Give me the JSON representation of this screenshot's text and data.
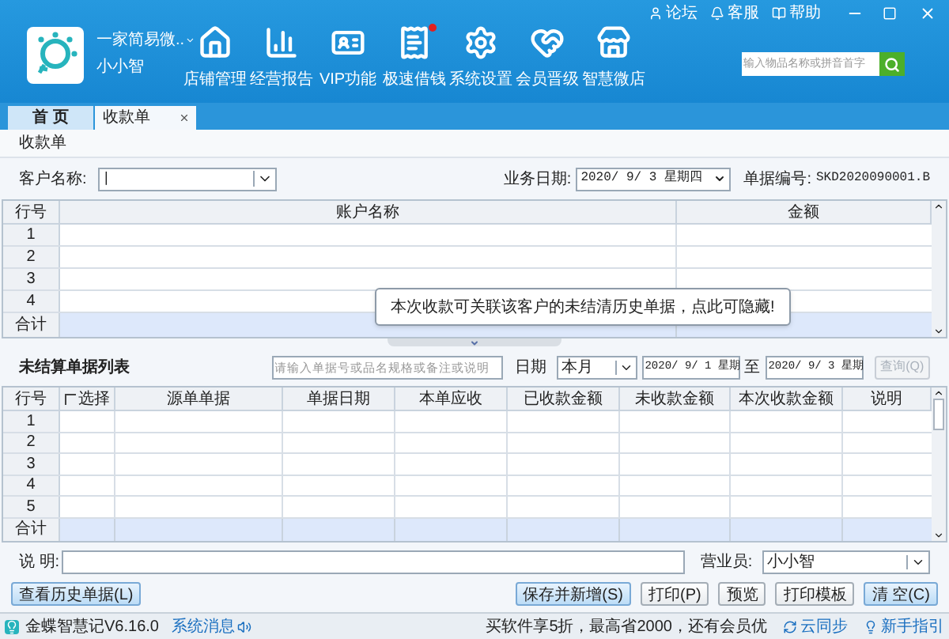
{
  "header": {
    "shop_name": "一家简易微..",
    "user": "小小智",
    "nav": [
      {
        "label": "店铺管理",
        "kind": "home",
        "dot": false
      },
      {
        "label": "经营报告",
        "kind": "chart",
        "dot": false
      },
      {
        "label": "VIP功能",
        "kind": "card",
        "dot": false
      },
      {
        "label": "极速借钱",
        "kind": "loan",
        "dot": true
      },
      {
        "label": "系统设置",
        "kind": "gear",
        "dot": false
      },
      {
        "label": "会员晋级",
        "kind": "heart",
        "dot": false
      },
      {
        "label": "智慧微店",
        "kind": "store",
        "dot": false
      }
    ],
    "links": [
      {
        "label": "论坛",
        "kind": "user"
      },
      {
        "label": "客服",
        "kind": "bell"
      },
      {
        "label": "帮助",
        "kind": "book"
      }
    ],
    "search": {
      "placeholder": "输入物品名称或拼音首字"
    }
  },
  "tabs": [
    {
      "label": "首 页",
      "selected": false,
      "closable": false
    },
    {
      "label": "收款单",
      "selected": true,
      "closable": true
    }
  ],
  "form": {
    "title": "收款单",
    "customer_label": "客户名称:",
    "customer_value": "|",
    "date_label": "业务日期:",
    "date": "2020/ 9/ 3 星期四",
    "number_label": "单据编号:",
    "number": "SKD2020090001.B"
  },
  "accounts_table": {
    "columns": [
      "行号",
      "账户名称",
      "金额"
    ],
    "rows": [
      "1",
      "2",
      "3",
      "4"
    ],
    "total_label": "合计"
  },
  "tooltip": "本次收款可关联该客户的未结清历史单据，点此可隐藏!",
  "unsettled": {
    "title": "未结算单据列表",
    "search_placeholder": "请输入单据号或品名规格或备注或说明",
    "date_label": "日期",
    "period": "本月",
    "from": "2020/ 9/ 1 星期",
    "to_label": "至",
    "to": "2020/ 9/ 3 星期",
    "query": {
      "label": "查询(Q)",
      "disabled": true
    },
    "select_all": {
      "label": "选择",
      "checked": false
    },
    "columns": [
      "行号",
      "源单单据",
      "单据日期",
      "本单应收",
      "已收款金额",
      "未收款金额",
      "本次收款金额",
      "说明"
    ],
    "rows": [
      "1",
      "2",
      "3",
      "4",
      "5"
    ],
    "total_label": "合计"
  },
  "note_label": "说 明:",
  "salesperson_label": "营业员:",
  "salesperson": "小小智",
  "buttons": [
    {
      "label": "查看历史单据(L)",
      "primary": true
    },
    {
      "label": "保存并新增(S)",
      "primary": true
    },
    {
      "label": "打印(P)",
      "primary": false
    },
    {
      "label": "预览",
      "primary": false
    },
    {
      "label": "打印模板",
      "primary": false
    },
    {
      "label": "清 空(C)",
      "primary": true
    }
  ],
  "status_bar": {
    "app": "金蝶智慧记V6.16.0",
    "messages": "系统消息",
    "promo": "买软件享5折，最高省2000，还有会员优",
    "sync": "云同步",
    "guide": "新手指引"
  }
}
